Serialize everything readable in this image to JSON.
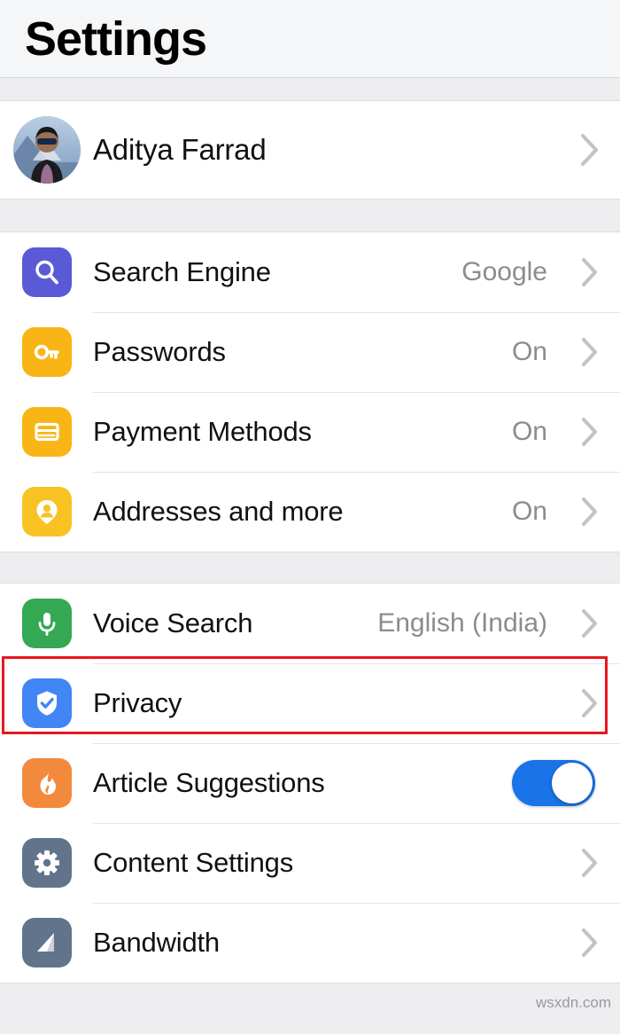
{
  "header": {
    "title": "Settings"
  },
  "profile": {
    "name": "Aditya Farrad",
    "avatar_icon": "user-photo-avatar",
    "chevron_icon": "chevron-right-icon"
  },
  "groups": [
    {
      "id": "account-group",
      "rows": [
        {
          "id": "search-engine",
          "label": "Search Engine",
          "value": "Google",
          "icon": "search-icon",
          "icon_color": "#5a5ad6",
          "accessory": "chevron"
        },
        {
          "id": "passwords",
          "label": "Passwords",
          "value": "On",
          "icon": "key-icon",
          "icon_color": "#f9b515",
          "accessory": "chevron"
        },
        {
          "id": "payment-methods",
          "label": "Payment Methods",
          "value": "On",
          "icon": "credit-card-icon",
          "icon_color": "#f9b515",
          "accessory": "chevron"
        },
        {
          "id": "addresses-and-more",
          "label": "Addresses and more",
          "value": "On",
          "icon": "address-pin-icon",
          "icon_color": "#f9c224",
          "accessory": "chevron"
        }
      ]
    },
    {
      "id": "privacy-group",
      "rows": [
        {
          "id": "voice-search",
          "label": "Voice Search",
          "value": "English (India)",
          "icon": "microphone-icon",
          "icon_color": "#34a853",
          "accessory": "chevron"
        },
        {
          "id": "privacy",
          "label": "Privacy",
          "value": "",
          "icon": "shield-check-icon",
          "icon_color": "#4285f4",
          "accessory": "chevron",
          "highlighted": true
        },
        {
          "id": "article-suggestions",
          "label": "Article Suggestions",
          "value": "",
          "icon": "flame-icon",
          "icon_color": "#f3893d",
          "accessory": "toggle",
          "toggle_on": true
        },
        {
          "id": "content-settings",
          "label": "Content Settings",
          "value": "",
          "icon": "gear-icon",
          "icon_color": "#61748c",
          "accessory": "chevron"
        },
        {
          "id": "bandwidth",
          "label": "Bandwidth",
          "value": "",
          "icon": "bandwidth-icon",
          "icon_color": "#61748c",
          "accessory": "chevron"
        }
      ]
    }
  ],
  "highlight": {
    "target": "privacy",
    "color": "#e8161f"
  },
  "footer": {
    "watermark": "wsxdn.com"
  }
}
